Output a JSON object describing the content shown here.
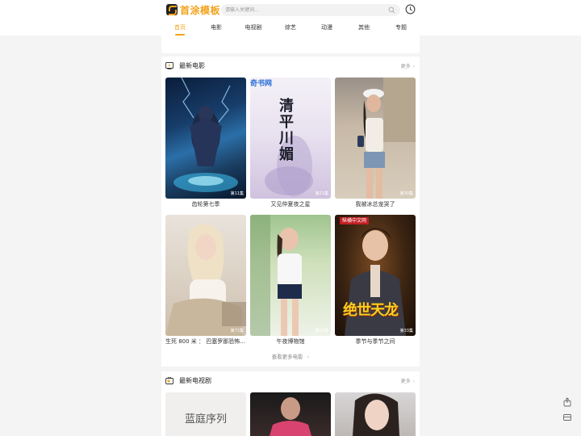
{
  "header": {
    "logo_text": "首涂模板",
    "search_placeholder": "请输入关键词...",
    "icons": [
      "search-icon",
      "history-icon"
    ]
  },
  "nav": {
    "tabs": [
      {
        "label": "首页",
        "active": true
      },
      {
        "label": "电影"
      },
      {
        "label": "电视剧"
      },
      {
        "label": "综艺"
      },
      {
        "label": "动漫"
      },
      {
        "label": "其他"
      },
      {
        "label": "专题"
      }
    ]
  },
  "colors": {
    "accent": "#f2a21b",
    "background": "#f4f4f4",
    "card": "#ffffff"
  },
  "movies": {
    "title": "最新电影",
    "more": "更多",
    "items": [
      {
        "title": "齿轮第七季",
        "badge": "第11集"
      },
      {
        "title": "又见仲夏夜之星",
        "badge": "第21集"
      },
      {
        "title": "我被冰总宠哭了",
        "badge": "第30集"
      },
      {
        "title": "生死 800 米 ： 巴塞罗那恐怖...",
        "badge": "第72集"
      },
      {
        "title": "午夜博物馆",
        "badge": "第54集"
      },
      {
        "title": "季节与季节之间",
        "badge": "第33集"
      }
    ],
    "view_more": "查看更多电影"
  },
  "poster_overlays": {
    "watermark_site": "奇书网",
    "poster2_calligraphy": "清平川媚",
    "poster6_source": "纵横中文网",
    "poster6_title": "绝世天龙"
  },
  "tv": {
    "title": "最新电视剧",
    "more": "更多",
    "poster1_text": "蓝庭序列"
  }
}
